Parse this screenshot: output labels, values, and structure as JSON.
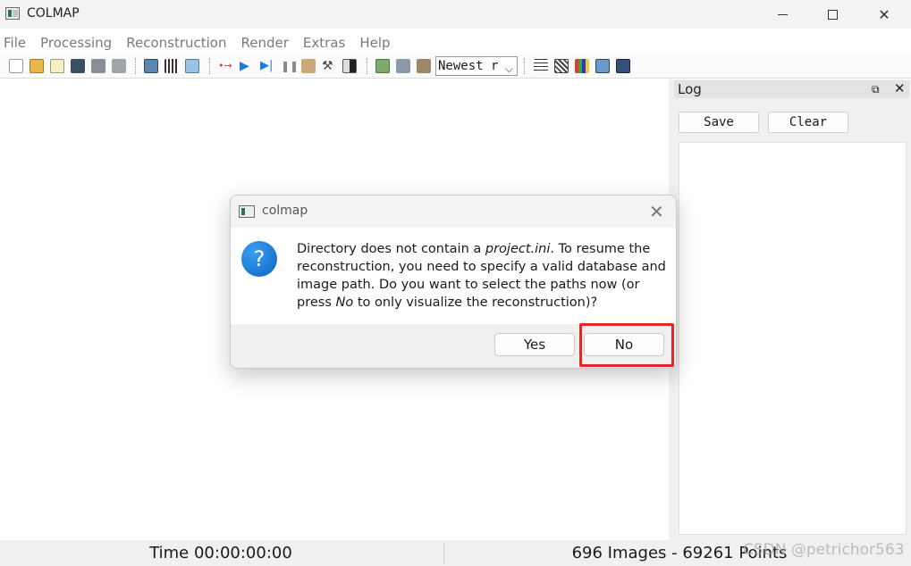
{
  "window": {
    "title": "COLMAP"
  },
  "menu": [
    "File",
    "Processing",
    "Reconstruction",
    "Render",
    "Extras",
    "Help"
  ],
  "toolbar": {
    "combo_value": "Newest r"
  },
  "log_dock": {
    "title": "Log",
    "save_label": "Save",
    "clear_label": "Clear"
  },
  "status": {
    "time": "Time 00:00:00:00",
    "summary": "696 Images - 69261 Points"
  },
  "watermark": "CSDN @petrichor563",
  "dialog": {
    "title": "colmap",
    "msg": {
      "p1": "Directory does not contain a ",
      "em1": "project.ini",
      "p2": ". To resume the reconstruction, you need to specify a valid database and image path. Do you want to select the paths now (or press ",
      "em2": "No",
      "p3": " to only visualize the reconstruction)?"
    },
    "yes_label": "Yes",
    "no_label": "No"
  },
  "colors": {
    "highlight": "#e3262a",
    "question_icon": "#1673d8"
  }
}
